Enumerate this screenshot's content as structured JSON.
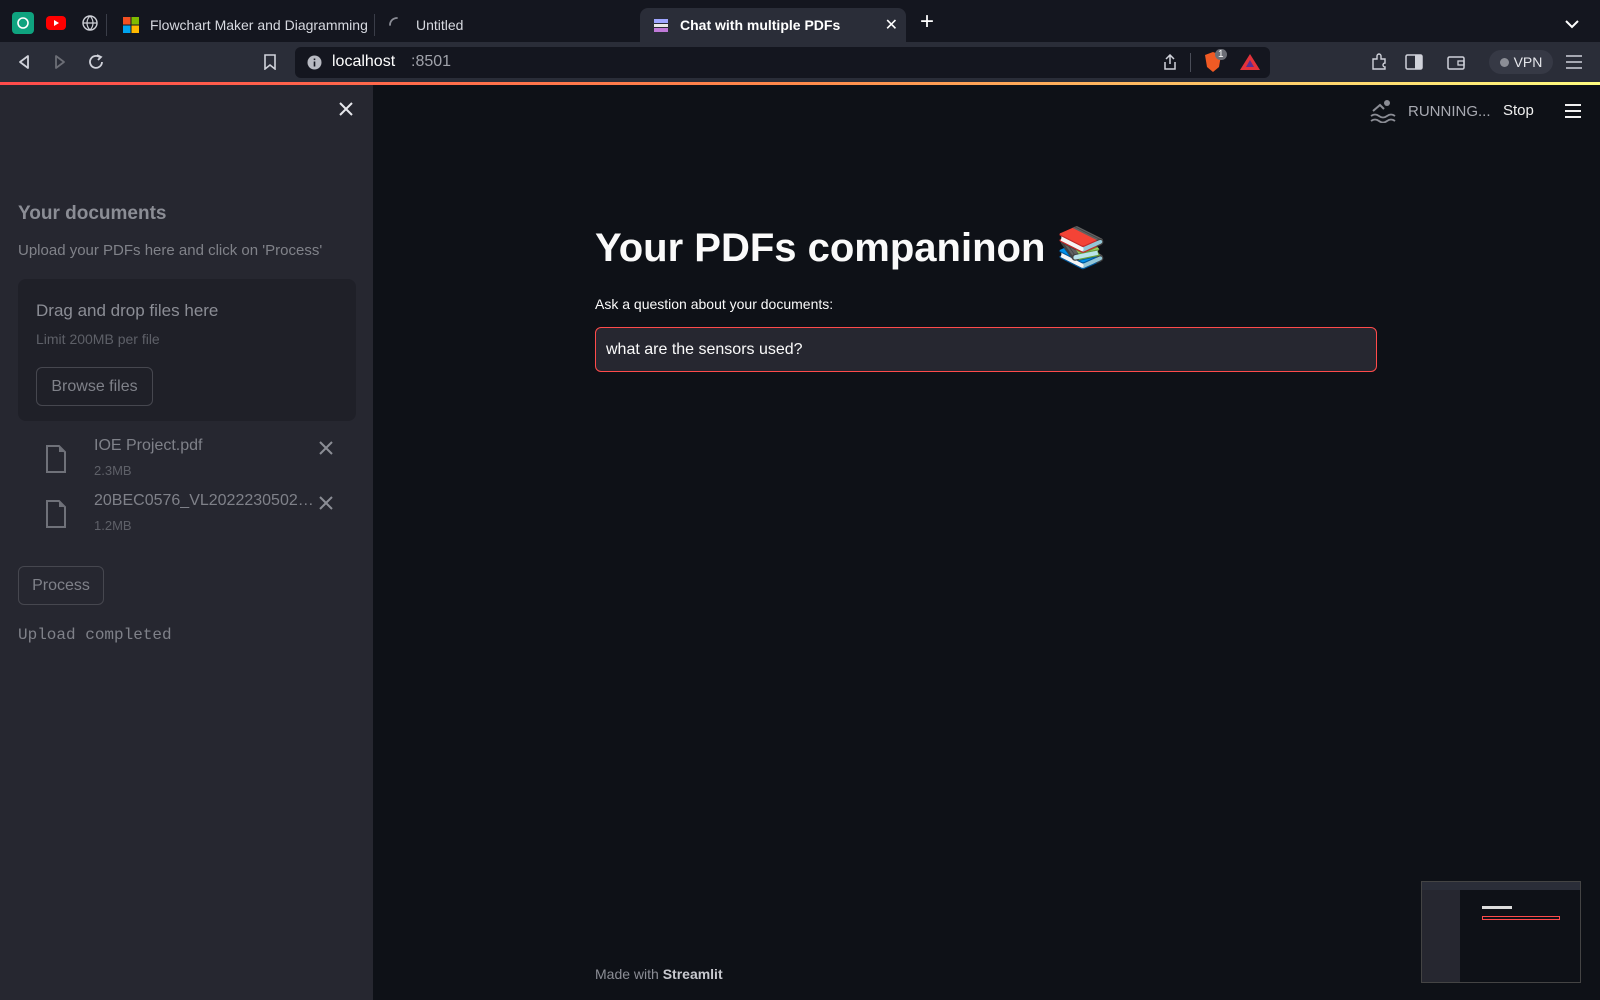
{
  "browser": {
    "tabs": [
      {
        "label": "Flowchart Maker and Diagramming S"
      },
      {
        "label": "Untitled"
      },
      {
        "label": "Chat with multiple PDFs"
      }
    ],
    "url_host": "localhost",
    "url_port": ":8501",
    "vpn_label": "VPN",
    "shield_count": "1"
  },
  "app": {
    "status": {
      "running": "RUNNING...",
      "stop": "Stop"
    },
    "sidebar": {
      "title": "Your documents",
      "subtitle": "Upload your PDFs here and click on 'Process'",
      "dropzone": {
        "text": "Drag and drop files here",
        "limit": "Limit 200MB per file",
        "browse": "Browse files"
      },
      "files": [
        {
          "name": "IOE Project.pdf",
          "size": "2.3MB"
        },
        {
          "name": "20BEC0576_VL2022230502…",
          "size": "1.2MB"
        }
      ],
      "process_label": "Process",
      "message": "Upload completed"
    },
    "main": {
      "title": "Your PDFs companinon 📚",
      "question_label": "Ask a question about your documents:",
      "question_value": "what are the sensors used?"
    },
    "footer": {
      "prefix": "Made with",
      "brand": "Streamlit"
    }
  },
  "colors": {
    "accent": "#ff4b4b",
    "background": "#0e1117",
    "sidebar": "#262730"
  }
}
